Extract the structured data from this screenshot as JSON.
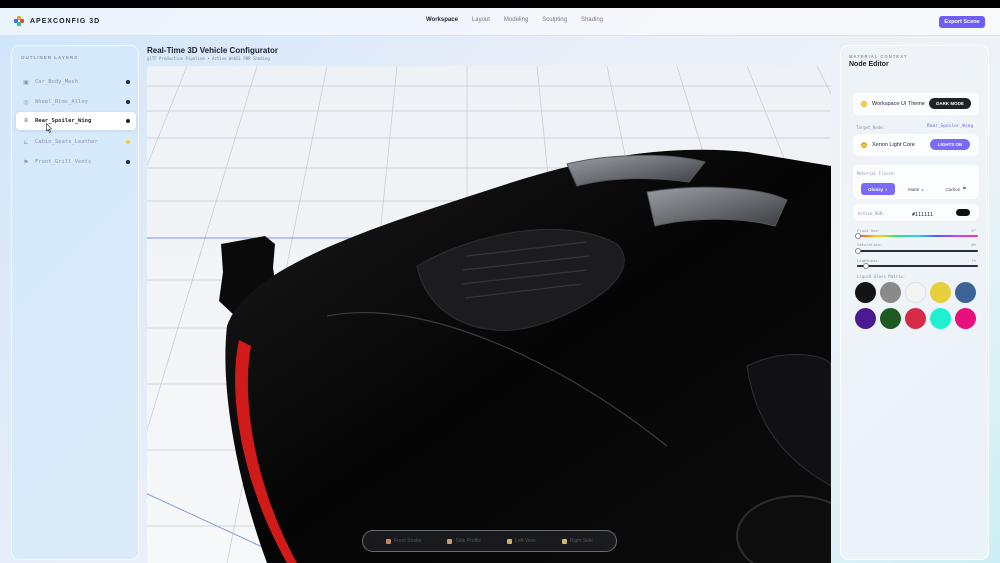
{
  "app": {
    "brand": "APEXCONFIG 3D",
    "nav": [
      "Workspace",
      "Layout",
      "Modeling",
      "Sculpting",
      "Shading"
    ],
    "active_nav": "Workspace",
    "export_label": "Export Scene",
    "accent": "#6f5df3"
  },
  "outliner": {
    "title": "OUTLINER LAYERS",
    "items": [
      {
        "label": "Car_Body_Mesh",
        "icon": "mesh-icon",
        "selected": false,
        "dot": "#1b2130"
      },
      {
        "label": "Wheel_Rims_Alloy",
        "icon": "wheel-icon",
        "selected": false,
        "dot": "#1b2130"
      },
      {
        "label": "Rear_Spoiler_Wing",
        "icon": "list-icon",
        "selected": true,
        "dot": "#1b2130"
      },
      {
        "label": "Cabin_Seats_Leather",
        "icon": "seat-icon",
        "selected": false,
        "dot": "#f0cf33"
      },
      {
        "label": "Front_Grill_Vents",
        "icon": "flag-icon",
        "selected": false,
        "dot": "#1b2130"
      }
    ]
  },
  "viewport": {
    "title": "Real-Time 3D Vehicle Configurator",
    "subtitle": "glTF Production Pipeline • Active WebGL PBR Shading",
    "toolbar": [
      {
        "label": "Front Studio",
        "icon": "camera-icon"
      },
      {
        "label": "Side Profile",
        "icon": "camera-icon"
      },
      {
        "label": "Left View",
        "icon": "camera-icon"
      },
      {
        "label": "Right Side",
        "icon": "camera-icon"
      }
    ]
  },
  "editor": {
    "context": "MATERIAL CONTEXT",
    "title": "Node Editor",
    "theme_label": "Workspace UI Theme",
    "theme_button": "DARK MODE",
    "target_label": "Target_Node:",
    "target_value": "Rear_Spoiler_Wing",
    "light_label": "Xenon Light Core",
    "light_button": "LIGHTS ON",
    "finish_label": "Material Finish:",
    "finishes": [
      {
        "label": "Glossy",
        "active": true
      },
      {
        "label": "Matte",
        "active": false
      },
      {
        "label": "Carbon",
        "active": false
      }
    ],
    "active_rgb_label": "Active_RGB:",
    "active_rgb_value": "#111111",
    "hue_label": "Fluid Hue:",
    "hue_value": "0°",
    "saturation_label": "Saturation:",
    "saturation_value": "0%",
    "lightness_label": "Lightness:",
    "lightness_value": "7%",
    "sliders": {
      "hue": 0.0,
      "saturation": 0.0,
      "lightness": 0.07
    },
    "matrix_label": "Liquid Glass Matrix:",
    "swatches": [
      "#141414",
      "#8a8a8a",
      "#f4f4f4",
      "#e8cf3d",
      "#3d6496",
      "#4b1a91",
      "#1f5a25",
      "#d82b45",
      "#1ff0d0",
      "#e8107e"
    ]
  }
}
